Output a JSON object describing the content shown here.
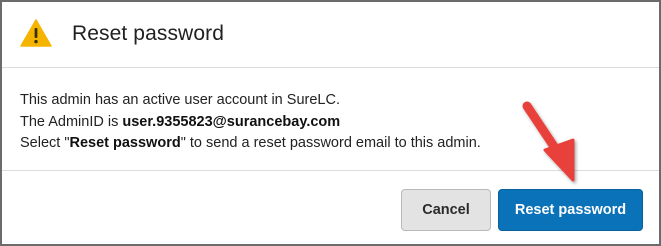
{
  "dialog": {
    "title": "Reset password",
    "icon": "warning-icon",
    "warning_color": "#f5b400"
  },
  "message": {
    "line1": "This admin has an active user account in SureLC.",
    "line2_prefix": "The AdminID is ",
    "admin_id": "user.9355823@surancebay.com",
    "line3_prefix": "Select \"",
    "line3_bold": "Reset password",
    "line3_suffix": "\" to send a reset password email to this admin."
  },
  "buttons": {
    "cancel_label": "Cancel",
    "reset_label": "Reset password"
  },
  "annotation": {
    "icon": "pointer-arrow-icon",
    "color": "#e8413a"
  }
}
